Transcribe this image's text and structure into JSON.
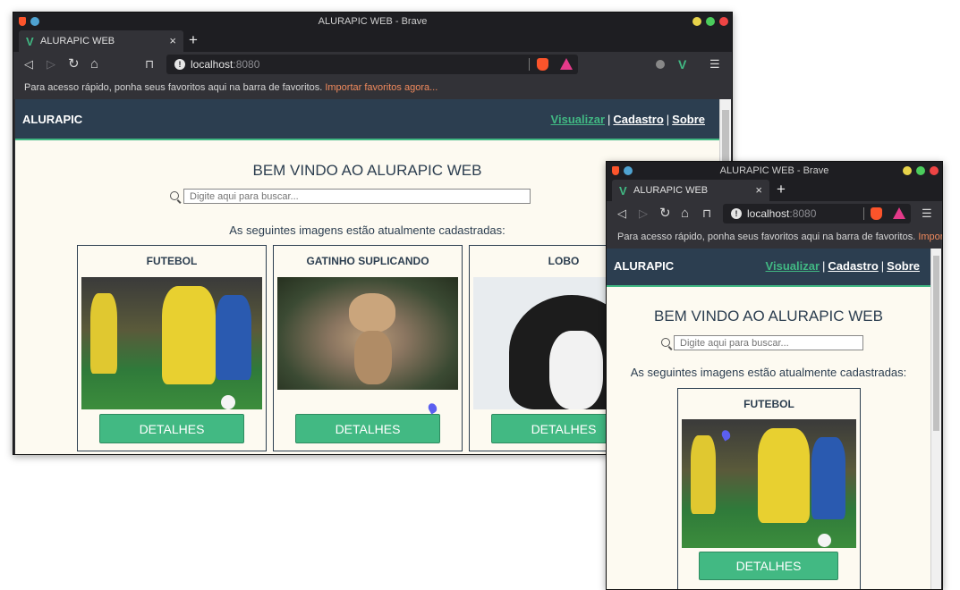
{
  "window_title": "ALURAPIC WEB - Brave",
  "tab": {
    "label": "ALURAPIC WEB",
    "close": "×",
    "new_tab": "+"
  },
  "nav": {
    "back": "◁",
    "forward": "▷",
    "reload": "↻",
    "home": "⌂",
    "bookmark": "⊓",
    "url_host": "localhost",
    "url_port": ":8080",
    "info": "!",
    "menu": "☰",
    "vue_ext": "V"
  },
  "bookmarks_bar": {
    "text": "Para acesso rápido, ponha seus favoritos aqui na barra de favoritos.",
    "link": "Importar favoritos agora...",
    "link_short": "Impor..."
  },
  "app": {
    "brand": "ALURAPIC",
    "nav_links": [
      "Visualizar",
      "Cadastro",
      "Sobre"
    ],
    "separator": "|",
    "title": "BEM VINDO AO ALURAPIC WEB",
    "search_placeholder": "Digite aqui para buscar...",
    "subtitle": "As seguintes imagens estão atualmente cadastradas:",
    "cards": [
      {
        "title": "FUTEBOL",
        "button": "DETALHES",
        "image": "soccer-players-photo"
      },
      {
        "title": "GATINHO SUPLICANDO",
        "button": "DETALHES",
        "image": "kitten-begging-photo"
      },
      {
        "title": "LOBO",
        "button": "DETALHES",
        "image": "husky-wolf-photo"
      }
    ]
  },
  "colors": {
    "header": "#2c3e50",
    "accent": "#41b883",
    "page_bg": "#fdfaf1",
    "link_orange": "#f08a5d"
  }
}
